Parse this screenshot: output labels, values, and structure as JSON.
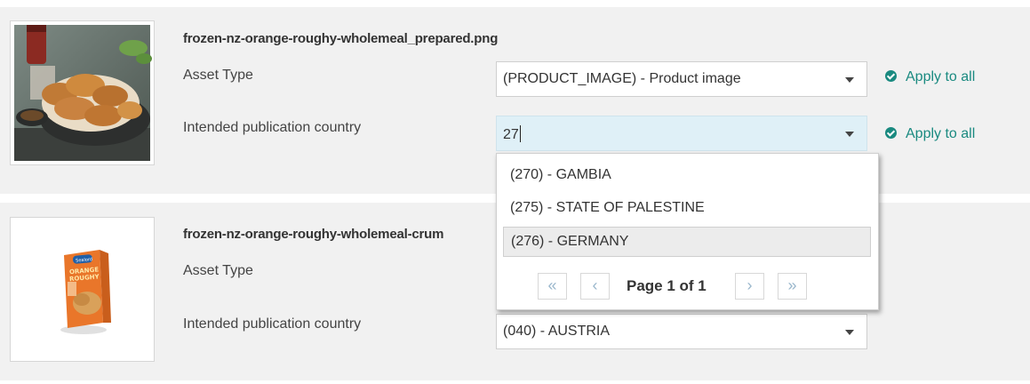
{
  "assets": [
    {
      "filename": "frozen-nz-orange-roughy-wholemeal_prepared.png",
      "asset_type_label": "Asset Type",
      "asset_type_value": "(PRODUCT_IMAGE) - Product image",
      "country_label": "Intended publication country",
      "country_input": "27",
      "apply_all_1": "Apply to all",
      "apply_all_2": "Apply to all"
    },
    {
      "filename": "frozen-nz-orange-roughy-wholemeal-crum",
      "asset_type_label": "Asset Type",
      "country_label": "Intended publication country",
      "country_value": "(040) - AUSTRIA"
    }
  ],
  "dropdown": {
    "options": [
      "(270) - GAMBIA",
      "(275) - STATE OF PALESTINE",
      "(276) - GERMANY"
    ],
    "highlighted": "(276) - GERMANY",
    "pager": {
      "first": "«",
      "prev": "‹",
      "label": "Page 1 of 1",
      "next": "›",
      "last": "»"
    }
  },
  "box_text": {
    "brand": "Sealord",
    "line1": "ORANGE",
    "line2": "ROUGHY"
  },
  "colors": {
    "accent": "#1a8a80",
    "focus_bg": "#dff0f7",
    "card_bg": "#f1f1f1"
  }
}
